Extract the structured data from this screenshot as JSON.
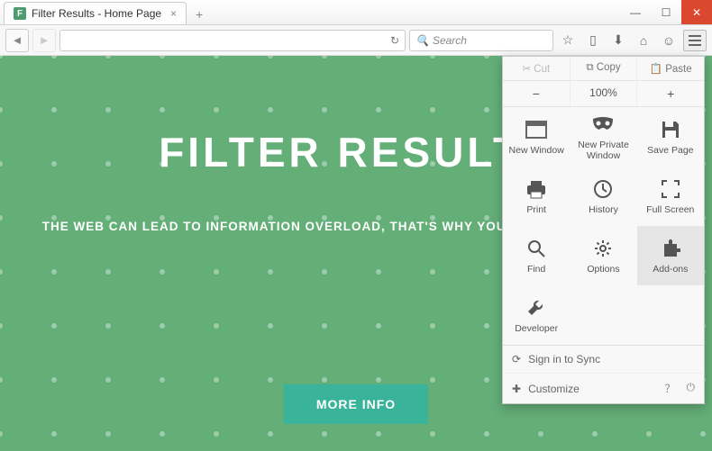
{
  "window": {
    "tab_title": "Filter Results - Home Page",
    "favicon_letter": "F"
  },
  "toolbar": {
    "search_placeholder": "Search"
  },
  "page": {
    "heading": "FILTER RESULTS",
    "subheading": "THE WEB CAN LEAD TO INFORMATION OVERLOAD, THAT'S WHY YOU NEED FILTER RESULTS.",
    "cta": "MORE INFO"
  },
  "menu": {
    "edit": {
      "cut": "Cut",
      "copy": "Copy",
      "paste": "Paste"
    },
    "zoom": {
      "minus": "−",
      "level": "100%",
      "plus": "+"
    },
    "items": [
      {
        "label": "New Window"
      },
      {
        "label": "New Private Window"
      },
      {
        "label": "Save Page"
      },
      {
        "label": "Print"
      },
      {
        "label": "History"
      },
      {
        "label": "Full Screen"
      },
      {
        "label": "Find"
      },
      {
        "label": "Options"
      },
      {
        "label": "Add-ons"
      },
      {
        "label": "Developer"
      }
    ],
    "sign_in": "Sign in to Sync",
    "customize": "Customize"
  }
}
